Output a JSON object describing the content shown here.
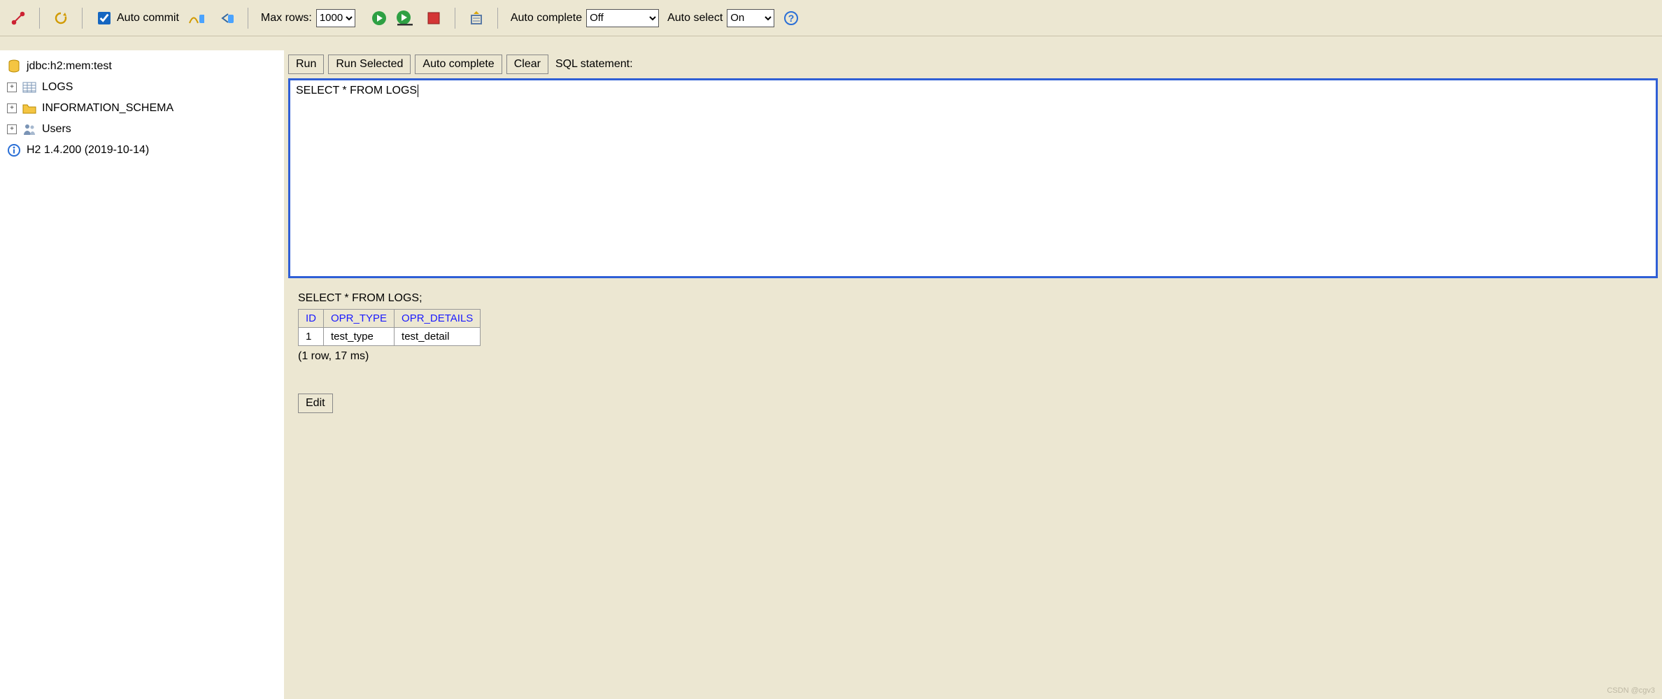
{
  "toolbar": {
    "auto_commit_label": "Auto commit",
    "auto_commit_checked": true,
    "max_rows_label": "Max rows:",
    "max_rows_value": "1000",
    "auto_complete_label": "Auto complete",
    "auto_complete_value": "Off",
    "auto_select_label": "Auto select",
    "auto_select_value": "On"
  },
  "tree": {
    "connection": "jdbc:h2:mem:test",
    "items": [
      {
        "label": "LOGS",
        "kind": "table"
      },
      {
        "label": "INFORMATION_SCHEMA",
        "kind": "schema"
      },
      {
        "label": "Users",
        "kind": "users"
      }
    ],
    "version": "H2 1.4.200 (2019-10-14)"
  },
  "sqlbar": {
    "run": "Run",
    "run_selected": "Run Selected",
    "auto_complete": "Auto complete",
    "clear": "Clear",
    "stmt_label": "SQL statement:"
  },
  "editor": {
    "text": "SELECT * FROM LOGS"
  },
  "result": {
    "statement": "SELECT * FROM LOGS;",
    "columns": [
      "ID",
      "OPR_TYPE",
      "OPR_DETAILS"
    ],
    "rows": [
      [
        "1",
        "test_type",
        "test_detail"
      ]
    ],
    "rowcount_text": "(1 row, 17 ms)",
    "edit_label": "Edit"
  },
  "watermark": "CSDN @cgv3"
}
